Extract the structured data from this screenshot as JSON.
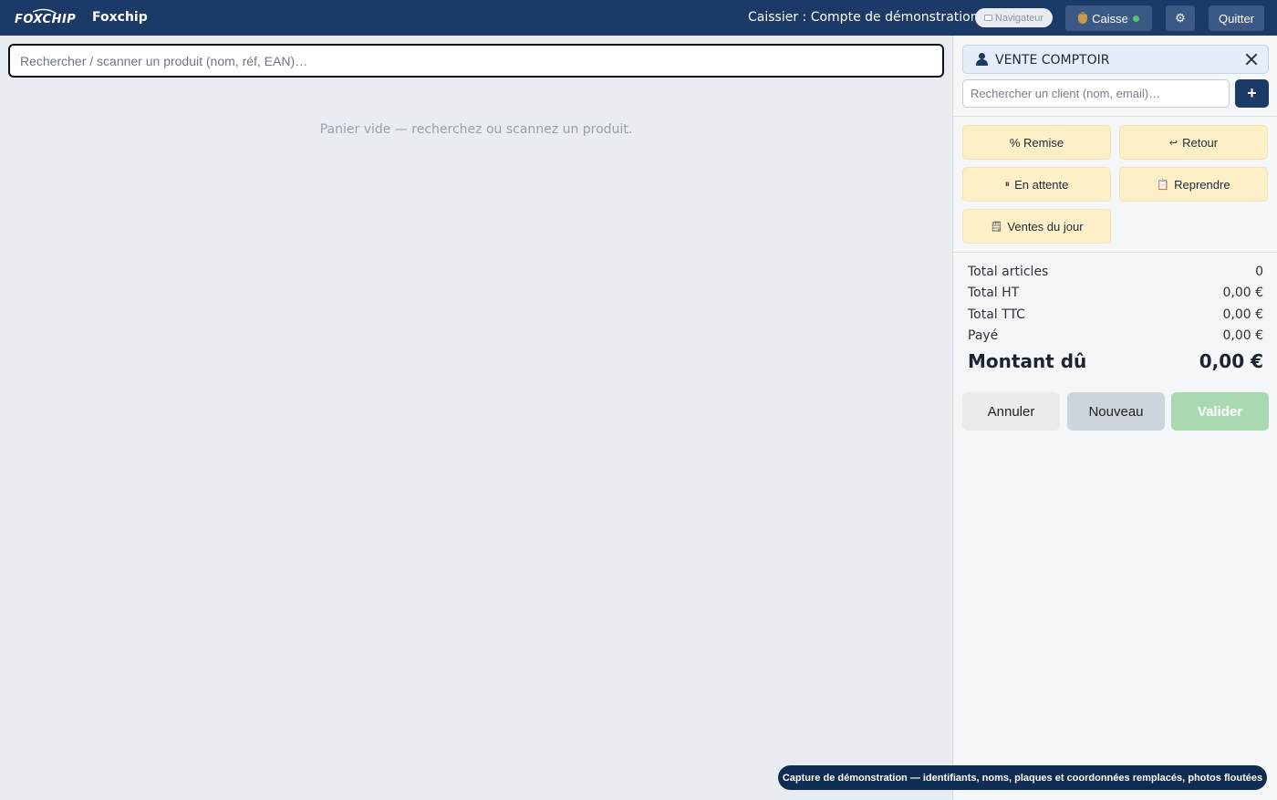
{
  "header": {
    "logo_text": "FOXCHIP",
    "brand": "Foxchip",
    "cashier": "Caissier : Compte de démonstration",
    "browser_pill": "Navigateur",
    "register_label": "Caisse",
    "register_status_color": "#4cc76b",
    "settings_icon": "⚙",
    "quit_label": "Quitter"
  },
  "main": {
    "search_placeholder": "Rechercher / scanner un produit (nom, réf, EAN)…",
    "empty_cart": "Panier vide — recherchez ou scannez un produit."
  },
  "panel": {
    "customer": {
      "title": "VENTE COMPTOIR",
      "search_placeholder": "Rechercher un client (nom, email)…",
      "add_label": "+"
    },
    "actions": [
      {
        "icon": "",
        "label": "% Remise"
      },
      {
        "icon": "↩",
        "label": "Retour"
      },
      {
        "icon": "⏸",
        "label": "En attente"
      },
      {
        "icon": "📋",
        "label": "Reprendre"
      },
      {
        "icon": "🗒",
        "label": "Ventes du jour"
      }
    ],
    "totals": [
      {
        "label": "Total articles",
        "value": "0"
      },
      {
        "label": "Total HT",
        "value": "0,00 €"
      },
      {
        "label": "Total TTC",
        "value": "0,00 €"
      },
      {
        "label": "Payé",
        "value": "0,00 €"
      }
    ],
    "amount_due": {
      "label": "Montant dû",
      "value": "0,00 €"
    },
    "buttons": {
      "cancel": "Annuler",
      "new": "Nouveau",
      "validate": "Valider"
    }
  },
  "toast": "Capture de démonstration — identifiants, noms, plaques et coordonnées remplacés, photos floutées",
  "colors": {
    "primary": "#1b3a68",
    "action_bg": "#fdf0c8",
    "validate_disabled": "#a8d9b0"
  }
}
